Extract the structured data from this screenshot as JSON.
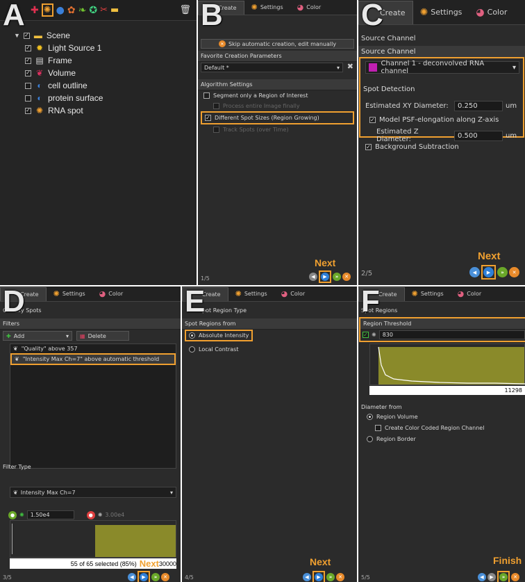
{
  "panelA": {
    "letter": "A",
    "tree": {
      "scene": "Scene",
      "items": [
        {
          "label": "Light Source 1",
          "checked": true,
          "icon": "light-icon",
          "glyph": "✹",
          "color": "#f0c020"
        },
        {
          "label": "Frame",
          "checked": true,
          "icon": "frame-icon",
          "glyph": "▤",
          "color": "#dddddd"
        },
        {
          "label": "Volume",
          "checked": true,
          "icon": "volume-icon",
          "glyph": "❦",
          "color": "#e03060"
        },
        {
          "label": "cell outline",
          "checked": false,
          "icon": "surface-icon",
          "glyph": "◐",
          "color": "#3a7fd8"
        },
        {
          "label": "protein surface",
          "checked": false,
          "icon": "surface-icon",
          "glyph": "◐",
          "color": "#3a7fd8"
        },
        {
          "label": "RNA spot",
          "checked": true,
          "icon": "spots-icon",
          "glyph": "✺",
          "color": "#f0a030"
        }
      ]
    }
  },
  "tabs": {
    "create": "Create",
    "settings": "Settings",
    "color": "Color"
  },
  "panelB": {
    "letter": "B",
    "skip_label": "Skip automatic creation, edit manually",
    "fav_header": "Favorite Creation Parameters",
    "fav_value": "Default *",
    "algo_header": "Algorithm Settings",
    "opts": [
      {
        "label": "Segment only a Region of Interest",
        "checked": false,
        "dim": false
      },
      {
        "label": "Process entire Image finally",
        "checked": false,
        "dim": true
      },
      {
        "label": "Different Spot Sizes (Region Growing)",
        "checked": true,
        "dim": false
      },
      {
        "label": "Track Spots (over Time)",
        "checked": false,
        "dim": true
      }
    ],
    "next": "Next",
    "page": "1/5"
  },
  "panelC": {
    "letter": "C",
    "header1": "Source Channel",
    "header2": "Source Channel",
    "channel": "Channel 1 - deconvolved RNA channel",
    "spot_header": "Spot Detection",
    "xy_label": "Estimated XY Diameter:",
    "xy_value": "0.250",
    "xy_unit": "um",
    "psf_label": "Model PSF-elongation along Z-axis",
    "z_label": "Estimated Z Diameter:",
    "z_value": "0.500",
    "z_unit": "um",
    "bg_label": "Background Subtraction",
    "next": "Next",
    "page": "2/5"
  },
  "panelD": {
    "letter": "D",
    "header": "Classify Spots",
    "filters_header": "Filters",
    "add": "Add",
    "delete": "Delete",
    "filters": [
      "\"Quality\" above 357",
      "\"Intensity Max Ch=7\" above automatic threshold"
    ],
    "filter_type_header": "Filter Type",
    "filter_type_value": "Intensity Max Ch=7",
    "lower_value": "1.50e4",
    "upper_value": "3.00e4",
    "selected": "55 of 65 selected (85%)",
    "next": "Next",
    "axis_max": "30000",
    "page": "3/5"
  },
  "panelE": {
    "letter": "E",
    "header": "Spot Region Type",
    "regions_from": "Spot Regions from",
    "opt1": "Absolute Intensity",
    "opt2": "Local Contrast",
    "next": "Next",
    "page": "4/5"
  },
  "panelF": {
    "letter": "F",
    "header": "Spot Regions",
    "threshold_header": "Region Threshold",
    "threshold_value": "830",
    "axis_max": "11298",
    "diameter_from": "Diameter from",
    "opt1": "Region Volume",
    "opt1_sub": "Create Color Coded Region Channel",
    "opt2": "Region Border",
    "finish": "Finish",
    "page": "5/5"
  }
}
